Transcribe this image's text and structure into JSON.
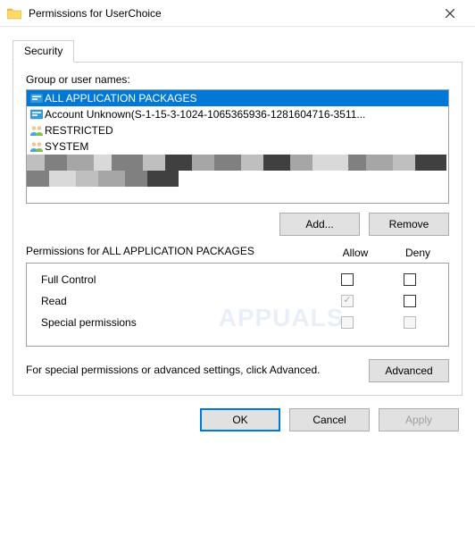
{
  "window": {
    "title": "Permissions for UserChoice"
  },
  "tab": {
    "security": "Security"
  },
  "groups": {
    "label": "Group or user names:",
    "items": [
      {
        "text": "ALL APPLICATION PACKAGES",
        "icon": "package",
        "selected": true
      },
      {
        "text": "Account Unknown(S-1-15-3-1024-1065365936-1281604716-3511...",
        "icon": "package",
        "selected": false
      },
      {
        "text": "RESTRICTED",
        "icon": "users",
        "selected": false
      },
      {
        "text": "SYSTEM",
        "icon": "users",
        "selected": false
      }
    ],
    "add_label": "Add...",
    "remove_label": "Remove"
  },
  "permissions": {
    "heading_prefix": "Permissions for ",
    "heading_subject": "ALL APPLICATION PACKAGES",
    "col_allow": "Allow",
    "col_deny": "Deny",
    "rows": [
      {
        "label": "Full Control",
        "allow": {
          "checked": false,
          "disabled": false
        },
        "deny": {
          "checked": false,
          "disabled": false
        }
      },
      {
        "label": "Read",
        "allow": {
          "checked": true,
          "disabled": true
        },
        "deny": {
          "checked": false,
          "disabled": false
        }
      },
      {
        "label": "Special permissions",
        "allow": {
          "checked": false,
          "disabled": true
        },
        "deny": {
          "checked": false,
          "disabled": true
        }
      }
    ]
  },
  "advanced": {
    "text": "For special permissions or advanced settings, click Advanced.",
    "button": "Advanced"
  },
  "footer": {
    "ok": "OK",
    "cancel": "Cancel",
    "apply": "Apply"
  },
  "watermark": "APPUALS"
}
